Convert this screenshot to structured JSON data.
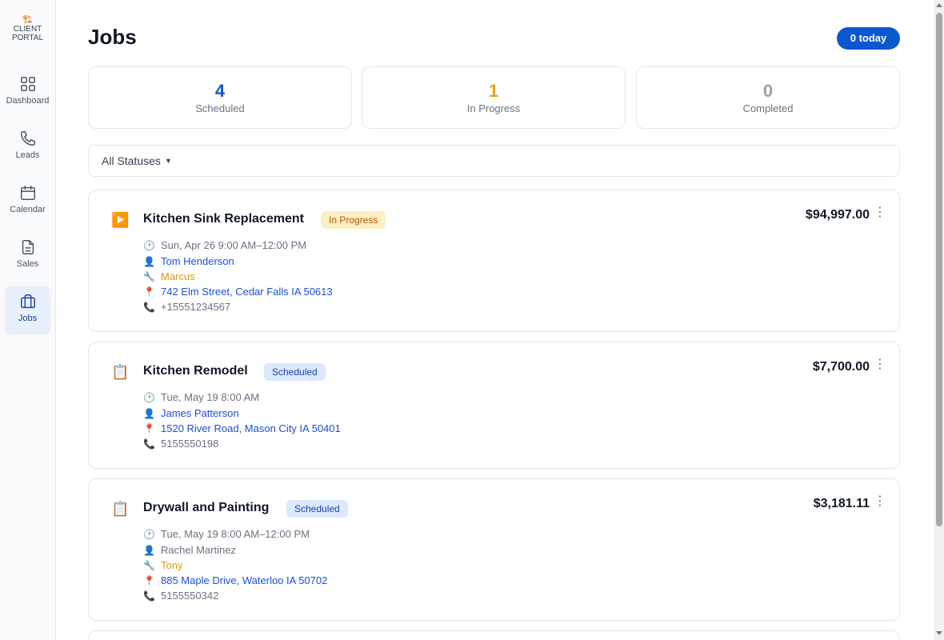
{
  "sidebar": {
    "brand": {
      "logo_icon": "crane-icon",
      "line1": "CLIENT",
      "line2": "PORTAL"
    },
    "items": [
      {
        "label": "Dashboard",
        "icon": "grid-icon",
        "active": false
      },
      {
        "label": "Leads",
        "icon": "phone-icon",
        "active": false
      },
      {
        "label": "Calendar",
        "icon": "calendar-icon",
        "active": false
      },
      {
        "label": "Sales",
        "icon": "document-icon",
        "active": false
      },
      {
        "label": "Jobs",
        "icon": "briefcase-icon",
        "active": true
      }
    ]
  },
  "header": {
    "title": "Jobs",
    "today_badge": "0 today"
  },
  "stats": [
    {
      "value": "4",
      "label": "Scheduled",
      "color": "#0b57d0"
    },
    {
      "value": "1",
      "label": "In Progress",
      "color": "#e8a317"
    },
    {
      "value": "0",
      "label": "Completed",
      "color": "#9ca3af"
    }
  ],
  "filter": {
    "selected": "All Statuses"
  },
  "jobs": [
    {
      "icon": "play-icon",
      "title": "Kitchen Sink Replacement",
      "status": "In Progress",
      "price": "$94,997.00",
      "time": "Sun, Apr 26 9:00 AM–12:00 PM",
      "customer": "Tom Henderson",
      "technician": "Marcus",
      "address": "742 Elm Street, Cedar Falls IA 50613",
      "phone": "+15551234567"
    },
    {
      "icon": "clipboard-icon",
      "title": "Kitchen Remodel",
      "status": "Scheduled",
      "price": "$7,700.00",
      "time": "Tue, May 19 8:00 AM",
      "customer": "James Patterson",
      "address": "1520 River Road, Mason City IA 50401",
      "phone": "5155550198"
    },
    {
      "icon": "clipboard-icon",
      "title": "Drywall and Painting",
      "status": "Scheduled",
      "price": "$3,181.11",
      "time": "Tue, May 19 8:00 AM–12:00 PM",
      "customer": "Rachel Martinez",
      "technician": "Tony",
      "address": "885 Maple Drive, Waterloo IA 50702",
      "phone": "5155550342"
    }
  ]
}
